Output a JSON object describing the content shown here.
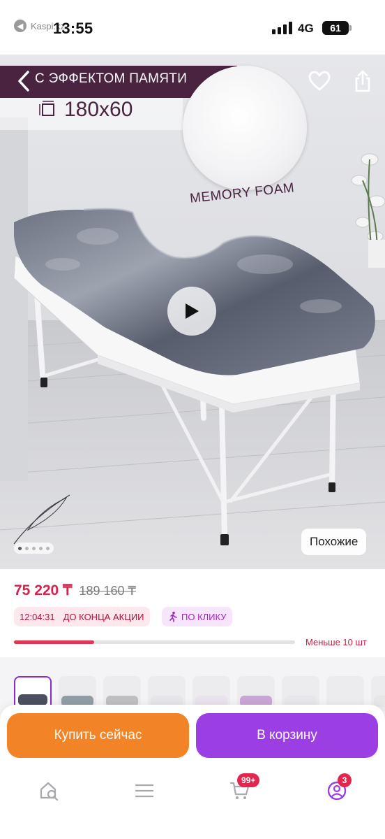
{
  "status_bar": {
    "back_app_label": "Kaspi.kz",
    "time": "13:55",
    "network": "4G",
    "battery": "61"
  },
  "product_image": {
    "banner_text": "С ЭФФЕКТОМ ПАМЯТИ",
    "size_text": "180x60",
    "memory_label": "MEMORY FOAM",
    "similar_button": "Похожие",
    "slide_count": 5,
    "active_slide": 1
  },
  "pricing": {
    "price": "75 220 ₸",
    "old_price": "189 160 ₸",
    "promo_timer": "12:04:31",
    "promo_label": "ДО КОНЦА АКЦИИ",
    "per_click_label": "ПО КЛИКУ",
    "stock_label": "Меньше 10 шт",
    "stock_level": 0.285
  },
  "thumbnails": {
    "selected_index": 0,
    "colors": [
      "#4b5060",
      "#8f9ea5",
      "#bfbfc2",
      "#e6e6ea",
      "#e9e3ee",
      "#c9a6d6",
      "#e8e8ec",
      "#ededf0",
      "#e6e6e6"
    ]
  },
  "actions": {
    "buy_now": "Купить сейчас",
    "add_to_cart": "В корзину"
  },
  "bottom_nav": {
    "cart_badge": "99+",
    "profile_badge": "3"
  },
  "colors": {
    "accent_purple": "#9b3fe4",
    "accent_orange": "#f28327",
    "price_red": "#d6224d"
  },
  "icons": [
    "back-chevron-icon",
    "heart-icon",
    "share-icon",
    "play-icon",
    "search-home-icon",
    "menu-icon",
    "cart-icon",
    "profile-icon",
    "measure-icon",
    "signal-icon"
  ]
}
